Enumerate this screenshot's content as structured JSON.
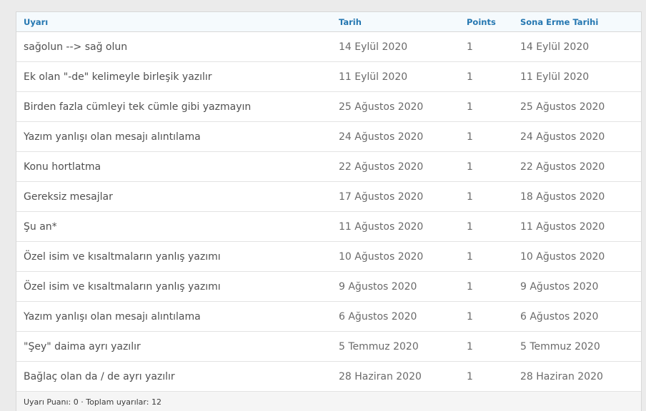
{
  "table": {
    "columns": {
      "uyari": "Uyarı",
      "tarih": "Tarih",
      "points": "Points",
      "sona_erme": "Sona Erme Tarihi"
    },
    "rows": [
      {
        "uyari": "sağolun --> sağ olun",
        "tarih": "14 Eylül 2020",
        "points": "1",
        "sona_erme": "14 Eylül 2020"
      },
      {
        "uyari": "Ek olan \"-de\" kelimeyle birleşik yazılır",
        "tarih": "11 Eylül 2020",
        "points": "1",
        "sona_erme": "11 Eylül 2020"
      },
      {
        "uyari": "Birden fazla cümleyi tek cümle gibi yazmayın",
        "tarih": "25 Ağustos 2020",
        "points": "1",
        "sona_erme": "25 Ağustos 2020"
      },
      {
        "uyari": "Yazım yanlışı olan mesajı alıntılama",
        "tarih": "24 Ağustos 2020",
        "points": "1",
        "sona_erme": "24 Ağustos 2020"
      },
      {
        "uyari": "Konu hortlatma",
        "tarih": "22 Ağustos 2020",
        "points": "1",
        "sona_erme": "22 Ağustos 2020"
      },
      {
        "uyari": "Gereksiz mesajlar",
        "tarih": "17 Ağustos 2020",
        "points": "1",
        "sona_erme": "18 Ağustos 2020"
      },
      {
        "uyari": "Şu an*",
        "tarih": "11 Ağustos 2020",
        "points": "1",
        "sona_erme": "11 Ağustos 2020"
      },
      {
        "uyari": "Özel isim ve kısaltmaların yanlış yazımı",
        "tarih": "10 Ağustos 2020",
        "points": "1",
        "sona_erme": "10 Ağustos 2020"
      },
      {
        "uyari": "Özel isim ve kısaltmaların yanlış yazımı",
        "tarih": "9 Ağustos 2020",
        "points": "1",
        "sona_erme": "9 Ağustos 2020"
      },
      {
        "uyari": "Yazım yanlışı olan mesajı alıntılama",
        "tarih": "6 Ağustos 2020",
        "points": "1",
        "sona_erme": "6 Ağustos 2020"
      },
      {
        "uyari": "\"Şey\" daima ayrı yazılır",
        "tarih": "5 Temmuz 2020",
        "points": "1",
        "sona_erme": "5 Temmuz 2020"
      },
      {
        "uyari": "Bağlaç olan da / de ayrı yazılır",
        "tarih": "28 Haziran 2020",
        "points": "1",
        "sona_erme": "28 Haziran 2020"
      }
    ]
  },
  "footer": {
    "summary": "Uyarı Puanı: 0 · Toplam uyarılar: 12"
  },
  "colors": {
    "header_text": "#2577b1",
    "header_bg": "#f5fafd",
    "page_bg": "#ebebeb",
    "cell_text": "#505050"
  }
}
